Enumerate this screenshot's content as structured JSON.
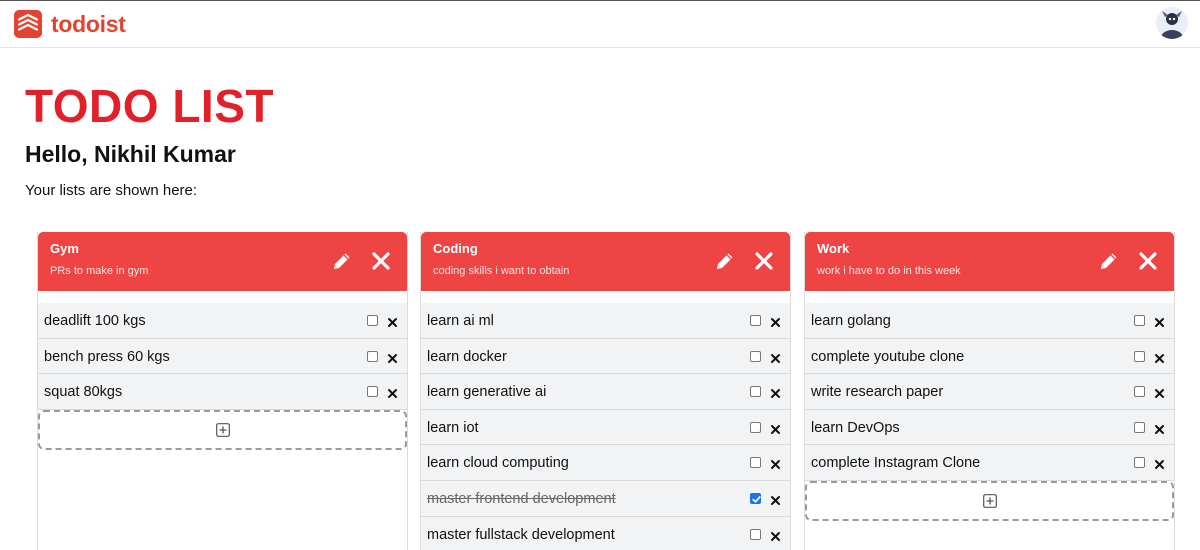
{
  "app": {
    "name": "todoist"
  },
  "header": {
    "title": "TODO LIST",
    "greeting": "Hello, Nikhil Kumar",
    "subtitle": "Your lists are shown here:"
  },
  "colors": {
    "brand": "#e44332",
    "title": "#e2202a",
    "board_header": "#ef4444",
    "checkbox_checked": "#1a73e8"
  },
  "boards": [
    {
      "name": "Gym",
      "description": "PRs to make in gym",
      "items": [
        {
          "text": "deadlift 100 kgs",
          "done": false
        },
        {
          "text": "bench press 60 kgs",
          "done": false
        },
        {
          "text": "squat 80kgs",
          "done": false
        }
      ]
    },
    {
      "name": "Coding",
      "description": "coding skills i want to obtain",
      "items": [
        {
          "text": "learn ai ml",
          "done": false
        },
        {
          "text": "learn docker",
          "done": false
        },
        {
          "text": "learn generative ai",
          "done": false
        },
        {
          "text": "learn iot",
          "done": false
        },
        {
          "text": "learn cloud computing",
          "done": false
        },
        {
          "text": "master frontend development",
          "done": true
        },
        {
          "text": "master fullstack development",
          "done": false
        }
      ]
    },
    {
      "name": "Work",
      "description": "work i have to do in this week",
      "items": [
        {
          "text": "learn golang",
          "done": false
        },
        {
          "text": "complete youtube clone",
          "done": false
        },
        {
          "text": "write research paper",
          "done": false
        },
        {
          "text": "learn DevOps",
          "done": false
        },
        {
          "text": "complete Instagram Clone",
          "done": false
        }
      ]
    }
  ],
  "icons": {
    "logo": "todoist-logo-icon",
    "edit": "pencil-icon",
    "delete": "close-icon",
    "add": "plus-square-icon",
    "item_delete": "x-icon"
  }
}
